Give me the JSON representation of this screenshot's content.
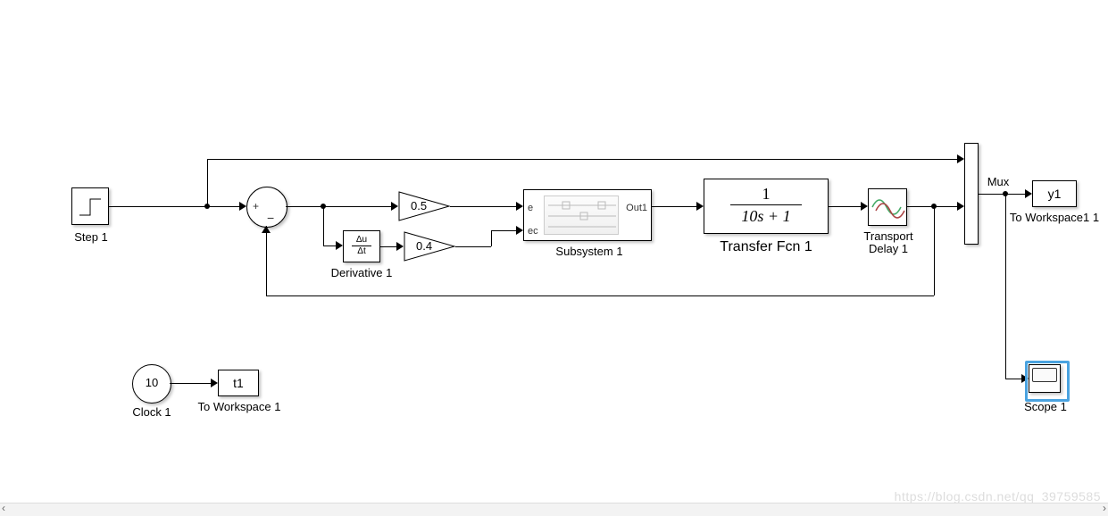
{
  "blocks": {
    "step": {
      "label": "Step 1"
    },
    "sum": {
      "signs": {
        "plus": "+",
        "minus": "−"
      }
    },
    "derivative": {
      "text_top": "Δu",
      "text_bot": "Δt",
      "label": "Derivative 1"
    },
    "gain1": {
      "value": "0.5"
    },
    "gain2": {
      "value": "0.4"
    },
    "subsystem": {
      "port_e": "e",
      "port_ec": "ec",
      "port_out": "Out1",
      "label": "Subsystem 1"
    },
    "transfer": {
      "num": "1",
      "den": "10s + 1",
      "label": "Transfer Fcn 1"
    },
    "delay": {
      "label": "Transport\nDelay 1"
    },
    "mux": {
      "label": "Mux"
    },
    "y1": {
      "text": "y1",
      "label": "To Workspace1 1"
    },
    "scope": {
      "label": "Scope 1"
    },
    "clock": {
      "value": "10",
      "label": "Clock 1"
    },
    "t1": {
      "text": "t1",
      "label": "To Workspace 1"
    }
  },
  "watermark": "https://blog.csdn.net/qq_39759585"
}
